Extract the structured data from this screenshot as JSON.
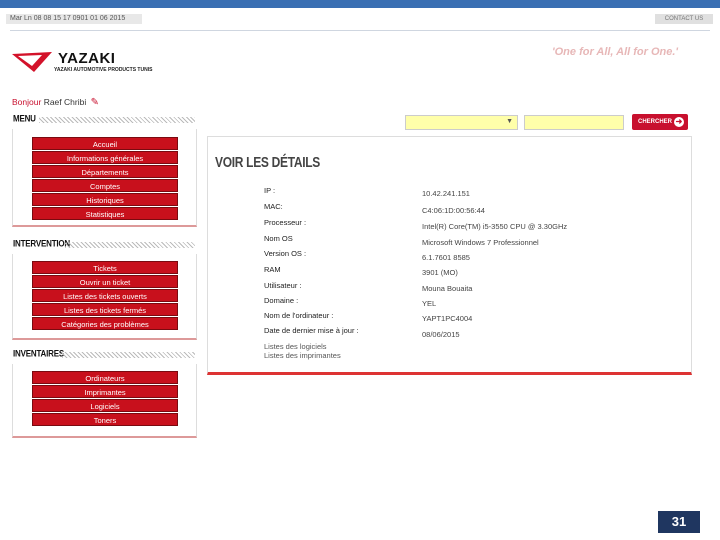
{
  "header": {
    "datebar": "Mar Ln 08 08 15 17 0901 01 06 2015",
    "contact": "CONTACT US",
    "brand": "YAZAKI",
    "brand_sub": "YAZAKI AUTOMOTIVE PRODUCTS TUNIS",
    "slogan": "'One for All, All for One.'"
  },
  "greeting": {
    "hello": "Bonjour",
    "name": "Raef Chribi"
  },
  "menu": {
    "title": "MENU",
    "items": [
      "Accueil",
      "Informations générales",
      "Départements",
      "Comptes",
      "Historiques",
      "Statistiques"
    ]
  },
  "intervention": {
    "title": "INTERVENTION",
    "items": [
      "Tickets",
      "Ouvrir un ticket",
      "Listes des tickets ouverts",
      "Listes des tickets fermés",
      "Catégories des problèmes"
    ]
  },
  "inventaires": {
    "title": "INVENTAIRES",
    "items": [
      "Ordinateurs",
      "Imprimantes",
      "Logiciels",
      "Toners"
    ]
  },
  "search": {
    "button": "CHERCHER"
  },
  "details": {
    "title": "VOIR LES DÉTAILS",
    "rows": [
      {
        "label": "IP :",
        "value": "10.42.241.151"
      },
      {
        "label": "MAC:",
        "value": "C4:06:1D:00:56:44"
      },
      {
        "label": "Processeur :",
        "value": "Intel(R) Core(TM) i5-3550 CPU @ 3.30GHz"
      },
      {
        "label": "Nom OS",
        "value": "Microsoft Windows 7 Professionnel"
      },
      {
        "label": "Version OS :",
        "value": "6.1.7601 8585"
      },
      {
        "label": "RAM",
        "value": "3901 (MO)"
      },
      {
        "label": "Utilisateur :",
        "value": "Mouna Bouaita"
      },
      {
        "label": "Domaine :",
        "value": "YEL"
      },
      {
        "label": "Nom de l'ordinateur :",
        "value": "YAPT1PC4004"
      },
      {
        "label": "Date de dernier mise à jour :",
        "value": "08/06/2015"
      }
    ],
    "links": [
      "Listes des logiciels",
      "Listes des imprimantes"
    ]
  },
  "page_number": "31",
  "colors": {
    "accent": "#c8102e",
    "topband": "#3a6fb3",
    "pagebox": "#1f3660"
  }
}
